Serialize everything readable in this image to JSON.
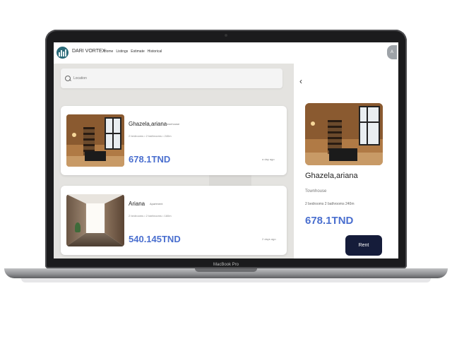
{
  "device": {
    "label": "MacBook Pro"
  },
  "nav": {
    "brand": "DARI VORTEX",
    "links": [
      "Home",
      "Listings",
      "Estimate",
      "Historical"
    ],
    "avatar_initial": "A"
  },
  "search": {
    "placeholder": "Location"
  },
  "listings": [
    {
      "name": "Ghazela,ariana",
      "type": "Townhouse",
      "specs": "2 bedrooms  •  2 bathrooms  •  240m",
      "price": "678.1TND",
      "time": "a day ago"
    },
    {
      "name": "Ariana",
      "type": "Apartment",
      "specs": "2 bedrooms  •  2 bathrooms  •  160m",
      "price": "540.145TND",
      "time": "2 days ago"
    }
  ],
  "detail": {
    "back_icon": "‹",
    "name": "Ghazela,ariana",
    "type": "Townhouse",
    "specs": "2 bedrooms 2 bathrooms 240m",
    "price": "678.1TND",
    "rent_label": "Rent"
  },
  "colors": {
    "price": "#4a6fcf",
    "rent_button": "#151c3a",
    "logo": "#2a6a78"
  }
}
